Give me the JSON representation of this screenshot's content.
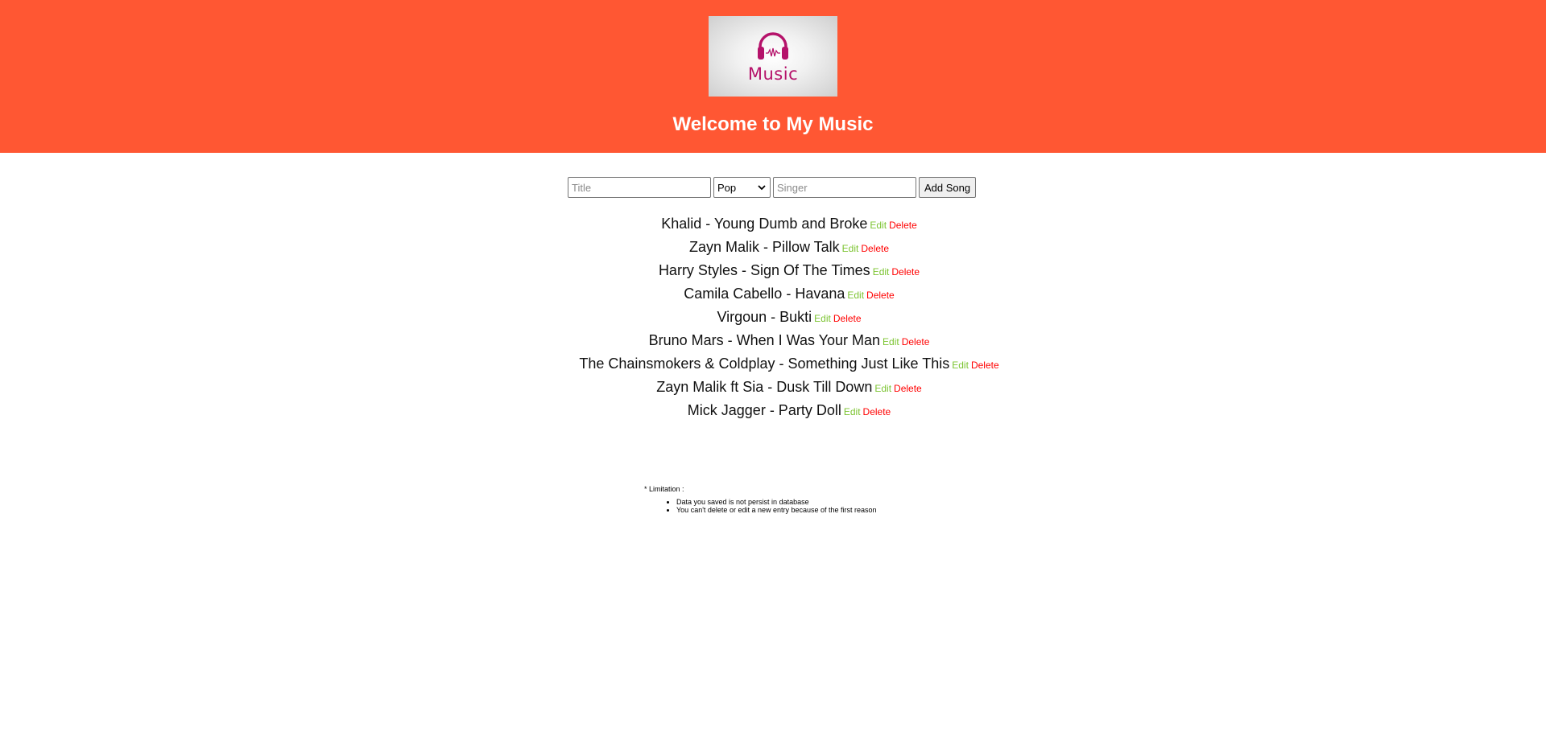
{
  "header": {
    "logo_text": "Music",
    "title": "Welcome to My Music",
    "logo_icon": "headphones-icon",
    "background_color": "#ff5733"
  },
  "form": {
    "title_placeholder": "Title",
    "genre_selected": "Pop",
    "singer_placeholder": "Singer",
    "add_label": "Add Song"
  },
  "actions": {
    "edit_label": "Edit",
    "delete_label": "Delete",
    "edit_color": "#7cc431",
    "delete_color": "#ff0000"
  },
  "songs": [
    {
      "text": "Khalid - Young Dumb and Broke"
    },
    {
      "text": "Zayn Malik - Pillow Talk"
    },
    {
      "text": "Harry Styles - Sign Of The Times"
    },
    {
      "text": "Camila Cabello - Havana"
    },
    {
      "text": "Virgoun - Bukti"
    },
    {
      "text": "Bruno Mars - When I Was Your Man"
    },
    {
      "text": "The Chainsmokers & Coldplay - Something Just Like This"
    },
    {
      "text": "Zayn Malik ft Sia - Dusk Till Down"
    },
    {
      "text": "Mick Jagger - Party Doll"
    }
  ],
  "notes": {
    "heading": "* Limitation :",
    "items": [
      "Data you saved is not persist in database",
      "You can't delete or edit a new entry because of the first reason"
    ]
  }
}
